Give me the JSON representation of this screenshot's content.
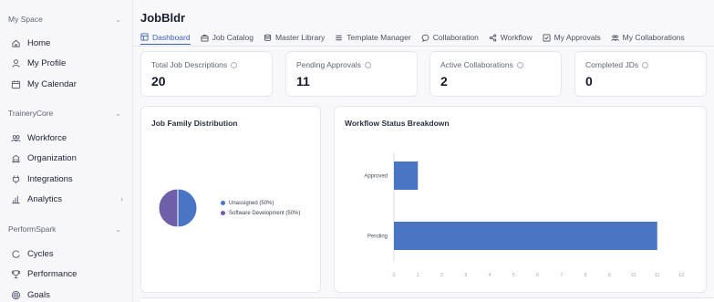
{
  "sidebar": {
    "sections": [
      {
        "title": "My Space",
        "items": [
          {
            "label": "Home",
            "icon": "home-icon"
          },
          {
            "label": "My Profile",
            "icon": "user-icon"
          },
          {
            "label": "My Calendar",
            "icon": "calendar-icon"
          }
        ]
      },
      {
        "title": "TraineryCore",
        "items": [
          {
            "label": "Workforce",
            "icon": "users-icon"
          },
          {
            "label": "Organization",
            "icon": "building-icon"
          },
          {
            "label": "Integrations",
            "icon": "plug-icon"
          },
          {
            "label": "Analytics",
            "icon": "chart-icon"
          }
        ]
      },
      {
        "title": "PerformSpark",
        "items": [
          {
            "label": "Cycles",
            "icon": "cycle-icon"
          },
          {
            "label": "Performance",
            "icon": "trophy-icon"
          },
          {
            "label": "Goals",
            "icon": "target-icon"
          }
        ]
      }
    ]
  },
  "header": {
    "title": "JobBldr"
  },
  "tabs": [
    {
      "label": "Dashboard",
      "icon": "dashboard-icon",
      "active": true
    },
    {
      "label": "Job Catalog",
      "icon": "briefcase-icon"
    },
    {
      "label": "Master Library",
      "icon": "database-icon"
    },
    {
      "label": "Template Manager",
      "icon": "list-icon"
    },
    {
      "label": "Collaboration",
      "icon": "chat-icon"
    },
    {
      "label": "Workflow",
      "icon": "share-icon"
    },
    {
      "label": "My Approvals",
      "icon": "check-square-icon"
    },
    {
      "label": "My Collaborations",
      "icon": "users-icon"
    }
  ],
  "stats": [
    {
      "label": "Total Job Descriptions",
      "value": "20"
    },
    {
      "label": "Pending Approvals",
      "value": "11"
    },
    {
      "label": "Active Collaborations",
      "value": "2"
    },
    {
      "label": "Completed JDs",
      "value": "0"
    }
  ],
  "panels": {
    "job_family_title": "Job Family Distribution",
    "workflow_title": "Workflow Status Breakdown"
  },
  "chart_data": [
    {
      "type": "pie",
      "title": "Job Family Distribution",
      "slices": [
        {
          "label": "Unassigned",
          "value": 50,
          "color": "#4a74c4"
        },
        {
          "label": "Software Development",
          "value": 50,
          "color": "#6f5fa8"
        }
      ],
      "legend_labels": [
        "Unassigned (50%)",
        "Software Development (50%)"
      ],
      "legend": "right"
    },
    {
      "type": "bar",
      "orientation": "horizontal",
      "title": "Workflow Status Breakdown",
      "categories": [
        "Approved",
        "Pending"
      ],
      "values": [
        1,
        11
      ],
      "color": "#4a74c4",
      "xlim": [
        0,
        12
      ],
      "xticks": [
        "0",
        "1",
        "2",
        "3",
        "4",
        "5",
        "6",
        "7",
        "8",
        "9",
        "10",
        "11",
        "12"
      ],
      "grid": false
    }
  ],
  "colors": {
    "accent": "#3a63b8",
    "bar": "#4a74c4",
    "slice_secondary": "#6f5fa8"
  }
}
